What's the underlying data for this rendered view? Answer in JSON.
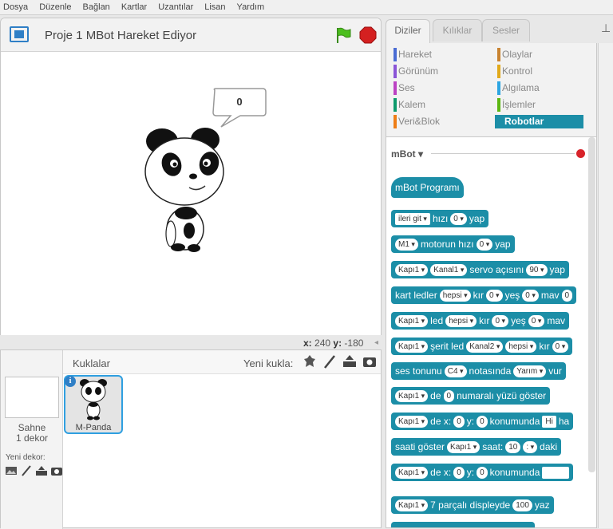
{
  "menu": [
    "Dosya",
    "Düzenle",
    "Bağlan",
    "Kartlar",
    "Uzantılar",
    "Lisan",
    "Yardım"
  ],
  "stage": {
    "project_title": "Proje 1 MBot Hareket Ediyor",
    "speech_value": "0",
    "x_label": "x:",
    "x_value": "240",
    "y_label": "y:",
    "y_value": "-180"
  },
  "sprites": {
    "header": "Kuklalar",
    "new_sprite_label": "Yeni kukla:",
    "stage_label_1": "Sahne",
    "stage_label_2": "1 dekor",
    "new_backdrop_label": "Yeni dekor:",
    "sprite_name": "M-Panda",
    "info_glyph": "i"
  },
  "tabs": [
    "Diziler",
    "Kılıklar",
    "Sesler"
  ],
  "categories": [
    {
      "label": "Hareket",
      "color": "#4a6cd4"
    },
    {
      "label": "Olaylar",
      "color": "#c88330"
    },
    {
      "label": "Görünüm",
      "color": "#8a55d7"
    },
    {
      "label": "Kontrol",
      "color": "#e1a91a"
    },
    {
      "label": "Ses",
      "color": "#bb42c3"
    },
    {
      "label": "Algılama",
      "color": "#2ca5e2"
    },
    {
      "label": "Kalem",
      "color": "#0e9a6c"
    },
    {
      "label": "İşlemler",
      "color": "#5cb712"
    },
    {
      "label": "Veri&Blok",
      "color": "#ee7d16"
    },
    {
      "label": "Robotlar",
      "color": "#1c8ea7"
    }
  ],
  "palette_header": "mBot ▾",
  "blocks": {
    "b0": {
      "t1": "mBot Programı"
    },
    "b1": {
      "p1": "ileri git",
      "t1": "hızı",
      "p2": "0",
      "t2": "yap"
    },
    "b2": {
      "p1": "M1",
      "t1": "motorun hızı",
      "p2": "0",
      "t2": "yap"
    },
    "b3": {
      "p1": "Kapı1",
      "p2": "Kanal1",
      "t1": "servo açısını",
      "p3": "90",
      "t2": "yap"
    },
    "b4": {
      "t1": "kart ledler",
      "p1": "hepsi",
      "t2": "kır",
      "p2": "0",
      "t3": "yeş",
      "p3": "0",
      "t4": "mav",
      "p4": "0"
    },
    "b5": {
      "p1": "Kapı1",
      "t1": "led",
      "p2": "hepsi",
      "t2": "kır",
      "p3": "0",
      "t3": "yeş",
      "p4": "0",
      "t4": "mav"
    },
    "b6": {
      "p1": "Kapı1",
      "t1": "şerit led",
      "p2": "Kanal2",
      "p3": "hepsi",
      "t2": "kır",
      "p4": "0"
    },
    "b7": {
      "t1": "ses tonunu",
      "p1": "C4",
      "t2": "notasında",
      "p2": "Yarım",
      "t3": "vur"
    },
    "b8": {
      "p1": "Kapı1",
      "t1": "de",
      "p2": "0",
      "t2": "numaralı yüzü göster"
    },
    "b9": {
      "p1": "Kapı1",
      "t1": "de x:",
      "p2": "0",
      "t2": "y:",
      "p3": "0",
      "t3": "konumunda",
      "p4": "Hi",
      "t4": "ha"
    },
    "b10": {
      "t1": "saati göster",
      "p1": "Kapı1",
      "t2": "saat:",
      "p2": "10",
      "p3": ":",
      "t3": "daki"
    },
    "b11": {
      "p1": "Kapı1",
      "t1": "de x:",
      "p2": "0",
      "t2": "y:",
      "p3": "0",
      "t3": "konumunda",
      "p4": ""
    },
    "b12": {
      "p1": "Kapı1",
      "t1": "7 parçalı displeyde",
      "p2": "100",
      "t2": "yaz"
    }
  }
}
